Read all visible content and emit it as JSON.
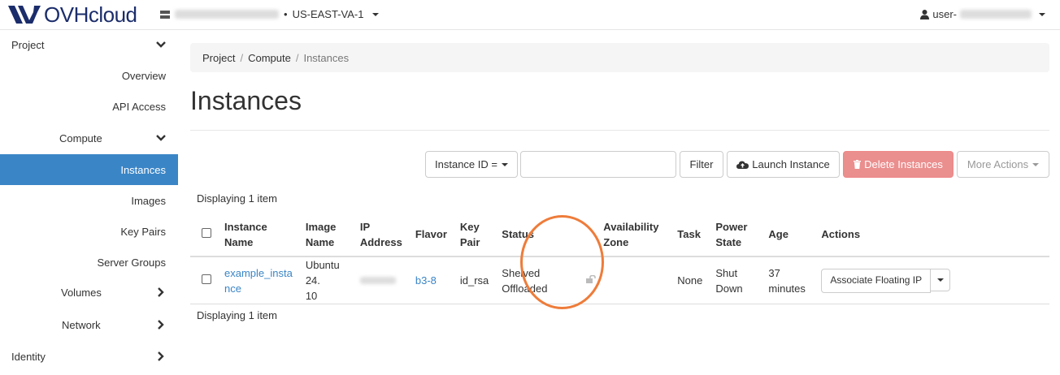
{
  "header": {
    "brand": "OVHcloud",
    "project_name_hidden": "••••••••••••••",
    "region": "US-EAST-VA-1",
    "user_prefix": "user-"
  },
  "sidebar": {
    "items": [
      {
        "label": "Project"
      },
      {
        "label": "Overview"
      },
      {
        "label": "API Access"
      },
      {
        "label": "Compute"
      },
      {
        "label": "Instances"
      },
      {
        "label": "Images"
      },
      {
        "label": "Key Pairs"
      },
      {
        "label": "Server Groups"
      },
      {
        "label": "Volumes"
      },
      {
        "label": "Network"
      },
      {
        "label": "Identity"
      }
    ]
  },
  "breadcrumb": [
    "Project",
    "Compute",
    "Instances"
  ],
  "page_title": "Instances",
  "toolbar": {
    "filter_select": "Instance ID =",
    "filter_value": "",
    "filter_button": "Filter",
    "launch_button": "Launch Instance",
    "delete_button": "Delete Instances",
    "more_button": "More Actions"
  },
  "summary_top": "Displaying 1 item",
  "summary_bottom": "Displaying 1 item",
  "table": {
    "headers": {
      "name": [
        "Instance",
        "Name"
      ],
      "image": [
        "Image",
        "Name"
      ],
      "ip": [
        "IP",
        "Address"
      ],
      "flavor": "Flavor",
      "keypair": [
        "Key",
        "Pair"
      ],
      "status": "Status",
      "az": [
        "Availability",
        "Zone"
      ],
      "task": "Task",
      "power": [
        "Power",
        "State"
      ],
      "age": "Age",
      "actions": "Actions"
    },
    "rows": [
      {
        "name": [
          "example_insta",
          "nce"
        ],
        "image": [
          "Ubuntu 24.",
          "10"
        ],
        "ip": "•••.•.•••",
        "flavor": "b3-8",
        "keypair": "id_rsa",
        "status": [
          "Shelved",
          "Offloaded"
        ],
        "az": "",
        "task": "None",
        "power": "Shut Down",
        "age": "37 minutes",
        "action": "Associate Floating IP"
      }
    ]
  },
  "colors": {
    "accent": "#3a85c6",
    "danger": "#eb8e8e",
    "highlight_circle": "#ee7c3a",
    "brand": "#1b2d6b"
  }
}
